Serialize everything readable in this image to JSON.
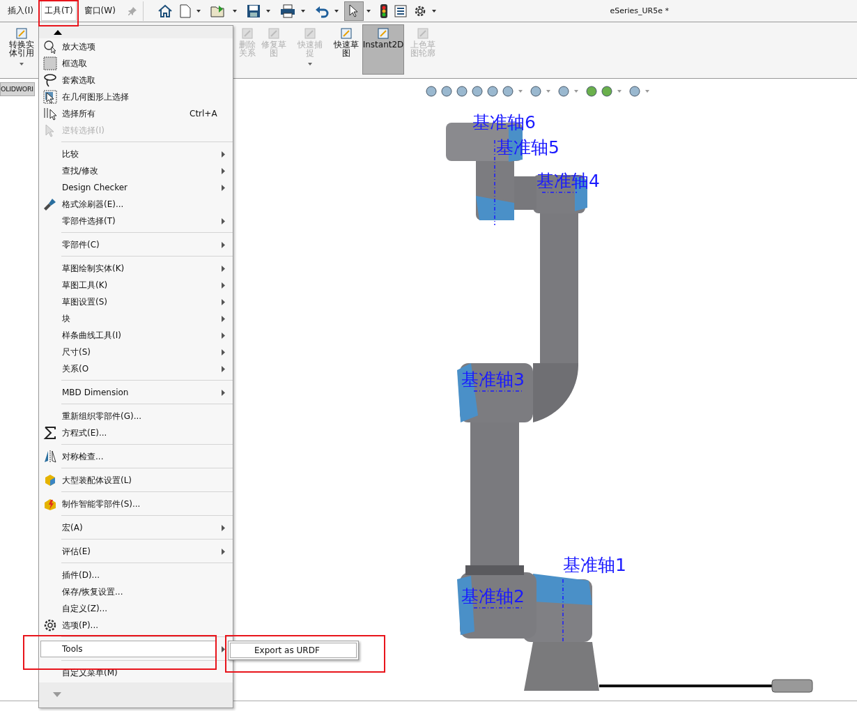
{
  "menu_bar": [
    {
      "label": "插入(I)",
      "selected": false
    },
    {
      "label": "工具(T)",
      "selected": true
    },
    {
      "label": "窗口(W)",
      "selected": false
    }
  ],
  "document_title": "eSeries_UR5e *",
  "ribbon": [
    {
      "lines": [
        "转换实",
        "体引用"
      ],
      "disabled": false,
      "selected": false,
      "caret": true
    },
    {
      "lines": [
        "删除",
        "关系"
      ],
      "disabled": true,
      "selected": false,
      "caret": false
    },
    {
      "lines": [
        "修复草",
        "图"
      ],
      "disabled": true,
      "selected": false,
      "caret": false
    },
    {
      "lines": [
        "快速捕",
        "捉"
      ],
      "disabled": true,
      "selected": false,
      "caret": true
    },
    {
      "lines": [
        "快速草",
        "图"
      ],
      "disabled": false,
      "selected": false,
      "caret": false
    },
    {
      "lines": [
        "Instant2D"
      ],
      "disabled": false,
      "selected": true,
      "caret": false
    },
    {
      "lines": [
        "上色草",
        "图轮廓"
      ],
      "disabled": true,
      "selected": false,
      "caret": false
    }
  ],
  "tab_strip": {
    "label": "OLIDWORI"
  },
  "menu": [
    {
      "kind": "item",
      "label": "放大选项",
      "submenu": false,
      "disabled": false,
      "selected": false
    },
    {
      "kind": "item",
      "label": "框选取",
      "submenu": false,
      "disabled": false,
      "selected": false
    },
    {
      "kind": "item",
      "label": "套索选取",
      "submenu": false,
      "disabled": false,
      "selected": false
    },
    {
      "kind": "item",
      "label": "在几何图形上选择",
      "submenu": false,
      "disabled": false,
      "selected": false
    },
    {
      "kind": "item",
      "label": "选择所有",
      "shortcut": "Ctrl+A",
      "submenu": false,
      "disabled": false,
      "selected": false
    },
    {
      "kind": "item",
      "label": "逆转选择(I)",
      "submenu": false,
      "disabled": true,
      "selected": false
    },
    {
      "kind": "separator"
    },
    {
      "kind": "item",
      "label": "比较",
      "submenu": true,
      "disabled": false,
      "selected": false
    },
    {
      "kind": "item",
      "label": "查找/修改",
      "submenu": true,
      "disabled": false,
      "selected": false
    },
    {
      "kind": "item",
      "label": "Design Checker",
      "submenu": true,
      "disabled": false,
      "selected": false
    },
    {
      "kind": "item",
      "label": "格式涂刷器(E)...",
      "submenu": false,
      "disabled": false,
      "selected": false
    },
    {
      "kind": "item",
      "label": "零部件选择(T)",
      "submenu": true,
      "disabled": false,
      "selected": false
    },
    {
      "kind": "separator"
    },
    {
      "kind": "item",
      "label": "零部件(C)",
      "submenu": true,
      "disabled": false,
      "selected": false
    },
    {
      "kind": "separator"
    },
    {
      "kind": "item",
      "label": "草图绘制实体(K)",
      "submenu": true,
      "disabled": false,
      "selected": false
    },
    {
      "kind": "item",
      "label": "草图工具(K)",
      "submenu": true,
      "disabled": false,
      "selected": false
    },
    {
      "kind": "item",
      "label": "草图设置(S)",
      "submenu": true,
      "disabled": false,
      "selected": false
    },
    {
      "kind": "item",
      "label": "块",
      "submenu": true,
      "disabled": false,
      "selected": false
    },
    {
      "kind": "item",
      "label": "样条曲线工具(I)",
      "submenu": true,
      "disabled": false,
      "selected": false
    },
    {
      "kind": "item",
      "label": "尺寸(S)",
      "submenu": true,
      "disabled": false,
      "selected": false
    },
    {
      "kind": "item",
      "label": "关系(O",
      "submenu": true,
      "disabled": false,
      "selected": false
    },
    {
      "kind": "separator"
    },
    {
      "kind": "item",
      "label": "MBD Dimension",
      "submenu": true,
      "disabled": false,
      "selected": false
    },
    {
      "kind": "separator"
    },
    {
      "kind": "item",
      "label": "重新组织零部件(G)...",
      "submenu": false,
      "disabled": false,
      "selected": false
    },
    {
      "kind": "item",
      "label": "方程式(E)...",
      "submenu": false,
      "disabled": false,
      "selected": false
    },
    {
      "kind": "separator"
    },
    {
      "kind": "item",
      "label": "对称检查...",
      "submenu": false,
      "disabled": false,
      "selected": false
    },
    {
      "kind": "separator"
    },
    {
      "kind": "item",
      "label": "大型装配体设置(L)",
      "submenu": false,
      "disabled": false,
      "selected": false
    },
    {
      "kind": "separator"
    },
    {
      "kind": "item",
      "label": "制作智能零部件(S)...",
      "submenu": false,
      "disabled": false,
      "selected": false
    },
    {
      "kind": "separator"
    },
    {
      "kind": "item",
      "label": "宏(A)",
      "submenu": true,
      "disabled": false,
      "selected": false
    },
    {
      "kind": "separator"
    },
    {
      "kind": "item",
      "label": "评估(E)",
      "submenu": true,
      "disabled": false,
      "selected": false
    },
    {
      "kind": "separator"
    },
    {
      "kind": "item",
      "label": "插件(D)...",
      "submenu": false,
      "disabled": false,
      "selected": false
    },
    {
      "kind": "item",
      "label": "保存/恢复设置...",
      "submenu": false,
      "disabled": false,
      "selected": false
    },
    {
      "kind": "item",
      "label": "自定义(Z)...",
      "submenu": false,
      "disabled": false,
      "selected": false
    },
    {
      "kind": "item",
      "label": "选项(P)...",
      "submenu": false,
      "disabled": false,
      "selected": false
    },
    {
      "kind": "separator"
    },
    {
      "kind": "item",
      "label": "Tools",
      "submenu": true,
      "disabled": false,
      "selected": true
    },
    {
      "kind": "separator"
    },
    {
      "kind": "item",
      "label": "自定义菜单(M)",
      "submenu": false,
      "disabled": false,
      "selected": false
    }
  ],
  "submenu": [
    {
      "label": "Export as URDF"
    }
  ],
  "axis_labels": [
    {
      "label": "基准轴6"
    },
    {
      "label": "基准轴5"
    },
    {
      "label": "基准轴4"
    },
    {
      "label": "基准轴3"
    },
    {
      "label": "基准轴1"
    },
    {
      "label": "基准轴2"
    }
  ]
}
